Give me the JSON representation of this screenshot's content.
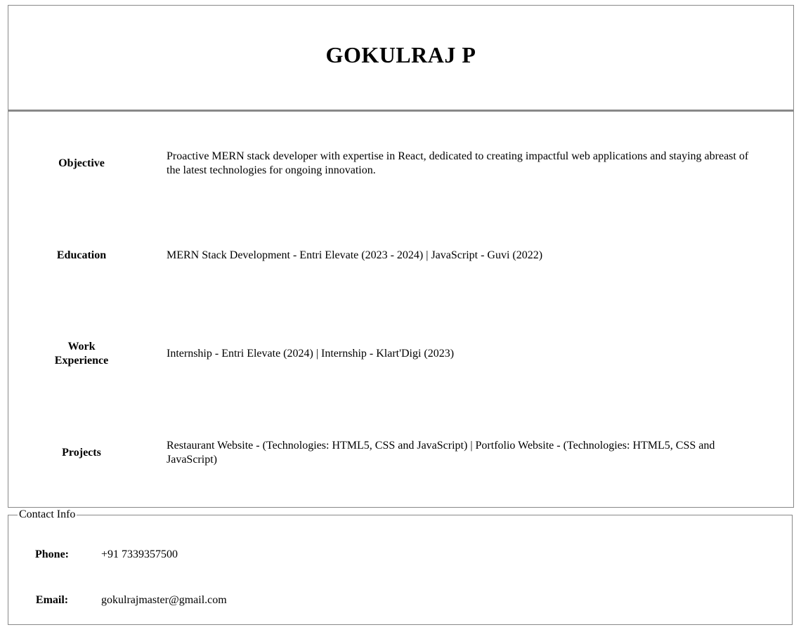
{
  "header": {
    "name": "GOKULRAJ P"
  },
  "sections": [
    {
      "label": "Objective",
      "content": "Proactive MERN stack developer with expertise in React, dedicated to creating impactful web applications and staying abreast of the latest technologies for ongoing innovation."
    },
    {
      "label": "Education",
      "content": "MERN Stack Development - Entri Elevate (2023 - 2024) | JavaScript - Guvi (2022)"
    },
    {
      "label": "Work Experience",
      "content": "Internship - Entri Elevate (2024) | Internship - Klart'Digi (2023)"
    },
    {
      "label": "Projects",
      "content": "Restaurant Website - (Technologies: HTML5, CSS and JavaScript) | Portfolio Website - (Technologies: HTML5, CSS and JavaScript)"
    }
  ],
  "contact": {
    "legend": "Contact Info",
    "phone_label": "Phone:",
    "phone_value": "+91 7339357500",
    "email_label": "Email:",
    "email_value": "gokulrajmaster@gmail.com"
  }
}
